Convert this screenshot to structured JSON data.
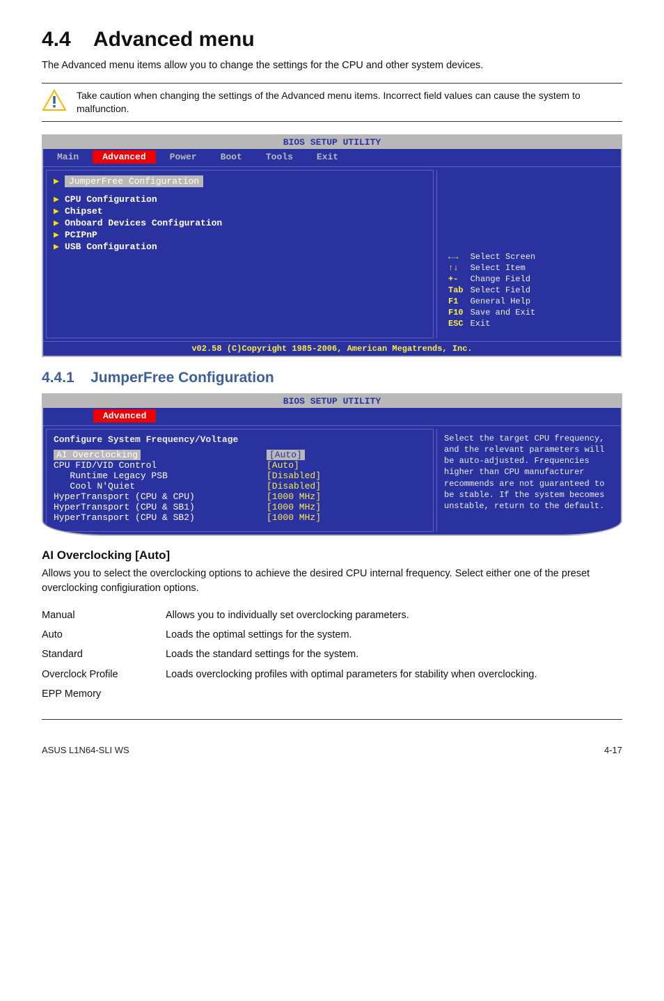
{
  "section": {
    "num": "4.4",
    "title": "Advanced menu",
    "intro": "The Advanced menu items allow you to change the settings for the CPU and other system devices."
  },
  "note": {
    "text": "Take caution when changing the settings of the Advanced menu items. Incorrect field values can cause the system to malfunction."
  },
  "bios1": {
    "topbar": "BIOS SETUP UTILITY",
    "tabs": [
      "Main",
      "Advanced",
      "Power",
      "Boot",
      "Tools",
      "Exit"
    ],
    "sel": "Advanced",
    "left_hl": "JumperFree Configuration",
    "left_items": [
      "CPU Configuration",
      "Chipset",
      "Onboard Devices Configuration",
      "PCIPnP",
      "USB Configuration"
    ],
    "help": [
      {
        "sym": "←→",
        "txt": "Select Screen"
      },
      {
        "sym": "↑↓",
        "txt": "Select Item"
      },
      {
        "sym": "+-",
        "txt": "Change Field"
      },
      {
        "sym": "Tab",
        "txt": "Select Field"
      },
      {
        "sym": "F1",
        "txt": "General Help"
      },
      {
        "sym": "F10",
        "txt": "Save and Exit"
      },
      {
        "sym": "ESC",
        "txt": "Exit"
      }
    ],
    "footer": "v02.58 (C)Copyright 1985-2006, American Megatrends, Inc."
  },
  "sub": {
    "num": "4.4.1",
    "title": "JumperFree Configuration"
  },
  "bios2": {
    "topbar": "BIOS SETUP UTILITY",
    "tab": "Advanced",
    "section_label": "Configure System Frequency/Voltage",
    "rows": [
      {
        "label": "AI Overclocking",
        "val": "[Auto]",
        "hl": true
      },
      {
        "label": "CPU FID/VID Control",
        "val": "[Auto]"
      },
      {
        "label": "   Runtime Legacy PSB",
        "val": "[Disabled]"
      },
      {
        "label": "   Cool N'Quiet",
        "val": "[Disabled]"
      },
      {
        "label": "HyperTransport (CPU & CPU)",
        "val": "[1000 MHz]"
      },
      {
        "label": "HyperTransport (CPU & SB1)",
        "val": "[1000 MHz]"
      },
      {
        "label": "HyperTransport (CPU & SB2)",
        "val": "[1000 MHz]"
      }
    ],
    "help": "Select the target CPU frequency, and the relevant parameters will be auto-adjusted. Frequencies higher than CPU manufacturer recommends are not guaranteed to be stable. If the system becomes unstable, return to the default."
  },
  "aiover": {
    "title": "AI Overclocking [Auto]",
    "intro": "Allows you to select the overclocking options to achieve the desired CPU internal frequency. Select either one of the preset overclocking configiuration options.",
    "opts": [
      {
        "k": "Manual",
        "v": "Allows you to individually set overclocking parameters."
      },
      {
        "k": "Auto",
        "v": "Loads the optimal settings for the system."
      },
      {
        "k": "Standard",
        "v": "Loads the standard settings for the system."
      },
      {
        "k": "Overclock Profile",
        "v": "Loads overclocking profiles with optimal parameters for stability when overclocking."
      },
      {
        "k": "EPP Memory",
        "v": ""
      }
    ]
  },
  "footer": {
    "left": "ASUS L1N64-SLI WS",
    "right": "4-17"
  }
}
